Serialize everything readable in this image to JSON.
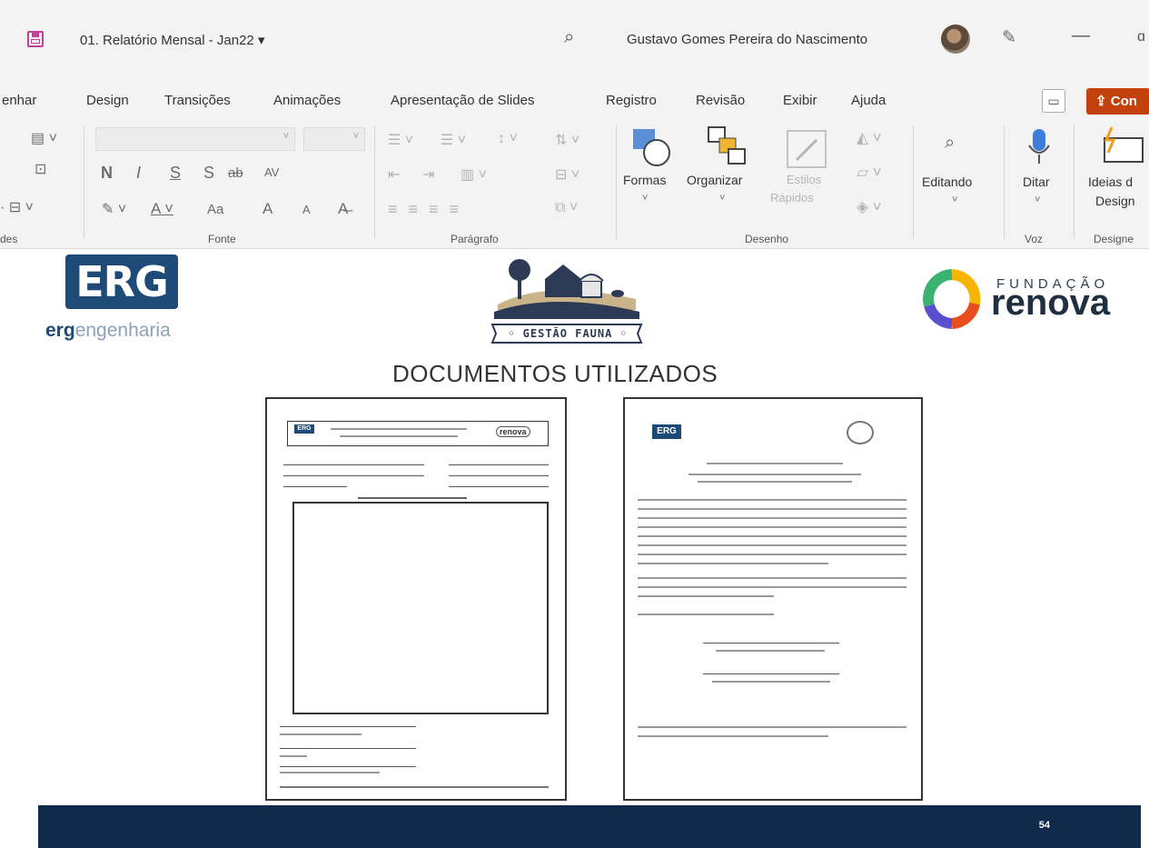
{
  "window": {
    "doc_title": "01. Relatório Mensal - Jan22 ▾",
    "user_name": "Gustavo Gomes Pereira do Nascimento",
    "minimize": "—",
    "maximize": "ɑ"
  },
  "ribbon_tabs": [
    "enhar",
    "Design",
    "Transições",
    "Animações",
    "Apresentação de Slides",
    "Registro",
    "Revisão",
    "Exibir",
    "Ajuda"
  ],
  "share_label": "Con",
  "ribbon": {
    "groups": {
      "slides": "des",
      "font": "Fonte",
      "paragraph": "Parágrafo",
      "drawing": "Desenho",
      "voice": "Voz",
      "designer": "Designe"
    },
    "buttons": {
      "shapes": "Formas",
      "arrange": "Organizar",
      "quick_styles_1": "Estilos",
      "quick_styles_2": "Rápidos",
      "editing": "Editando",
      "dictate": "Ditar",
      "design_ideas_1": "Ideias d",
      "design_ideas_2": "Design"
    },
    "font_tools": {
      "bold": "N",
      "italic": "I",
      "underline": "S",
      "shadow": "S",
      "strike": "ab",
      "spacing": "AV",
      "case": "Aa",
      "grow": "A",
      "shrink": "A"
    }
  },
  "slide": {
    "erg_logo": "ERG",
    "erg_tag_bold": "erg",
    "erg_tag_rest": "engenharia",
    "fauna_label": "◦ GESTÃO FAUNA ◦",
    "renova_small": "FUNDAÇÃO",
    "renova_big": "renova",
    "title": "DOCUMENTOS UTILIZADOS",
    "doc1_logo": "ERG",
    "doc1_renova": "renova",
    "doc2_logo": "ERG",
    "page_number": "54"
  }
}
